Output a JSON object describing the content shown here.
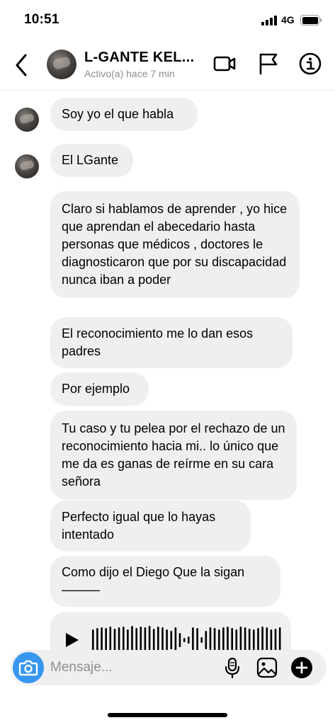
{
  "status_bar": {
    "time": "10:51",
    "network": "4G",
    "battery_level": 1.0
  },
  "header": {
    "contact_name": "L-GANTE KEL...",
    "contact_status": "Activo(a) hace 7 min",
    "icons": [
      "back-icon",
      "video-camera-icon",
      "flag-icon",
      "info-icon"
    ]
  },
  "messages": [
    {
      "text": "Soy yo el que habla"
    },
    {
      "text": "El LGante"
    },
    {
      "text": "Claro si hablamos de aprender , yo hice que aprendan el abecedario hasta personas que  médicos , doctores le diagnosticaron que por su discapacidad nunca iban a poder"
    },
    {
      "text": "El reconocimiento me lo dan esos padres"
    },
    {
      "text": "Por ejemplo"
    },
    {
      "text": "Tu caso y tu pelea por el rechazo de un reconocimiento hacia mi.. lo único que me da es ganas de reírme en su cara señora"
    },
    {
      "text": "Perfecto igual que lo hayas intentado"
    },
    {
      "text": "Como dijo el Diego Que la sigan ———"
    }
  ],
  "composer": {
    "placeholder": "Mensaje...",
    "value": "",
    "icons": [
      "camera-icon",
      "microphone-icon",
      "gallery-icon",
      "plus-icon"
    ]
  },
  "colors": {
    "accent": "#3797f0",
    "bubble_bg": "#efeff0",
    "muted_text": "#8e8e8e"
  }
}
